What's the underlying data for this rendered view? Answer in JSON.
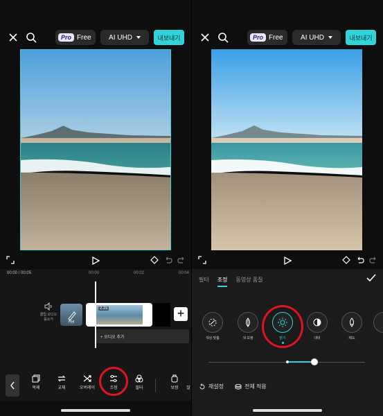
{
  "left": {
    "topbar": {
      "pro_label": "Pro",
      "free_label": "Free",
      "ai_label": "AI UHD",
      "export_label": "내보내기"
    },
    "time": {
      "current": "00:00",
      "total": "00:05"
    },
    "ruler": [
      "00:00",
      "00:02",
      "00:04"
    ],
    "audio_label": "클립 오디오 음소거",
    "cover_label": "커버",
    "clip_duration": "2.2s",
    "add_audio_label": "+ 오디오 추가",
    "tools": [
      {
        "label": "복제",
        "icon": "duplicate-icon"
      },
      {
        "label": "교체",
        "icon": "replace-icon"
      },
      {
        "label": "오버레이",
        "icon": "overlay-icon"
      },
      {
        "label": "조정",
        "icon": "adjust-icon"
      },
      {
        "label": "필터",
        "icon": "filter-icon"
      },
      {
        "label": "보정",
        "icon": "enhance-icon"
      },
      {
        "label": "잘",
        "icon": "crop-icon"
      }
    ],
    "highlight": "조정"
  },
  "right": {
    "topbar": {
      "pro_label": "Pro",
      "free_label": "Free",
      "ai_label": "AI UHD",
      "export_label": "내보내기"
    },
    "tabs": [
      {
        "label": "필터",
        "active": false
      },
      {
        "label": "조정",
        "active": true
      },
      {
        "label": "동영상 품질",
        "active": false
      }
    ],
    "adjustments": [
      {
        "label": "색상 맞춤",
        "icon": "color-match-icon"
      },
      {
        "label": "색 보정",
        "icon": "color-correct-icon"
      },
      {
        "label": "밝기",
        "icon": "brightness-icon",
        "active": true
      },
      {
        "label": "대비",
        "icon": "contrast-icon"
      },
      {
        "label": "채도",
        "icon": "saturation-icon"
      }
    ],
    "slider_value": 0.67,
    "reset_label": "재설정",
    "apply_all_label": "전체 적용",
    "highlight": "밝기"
  },
  "colors": {
    "accent": "#2fd3d9",
    "highlight_ring": "#e01520"
  }
}
